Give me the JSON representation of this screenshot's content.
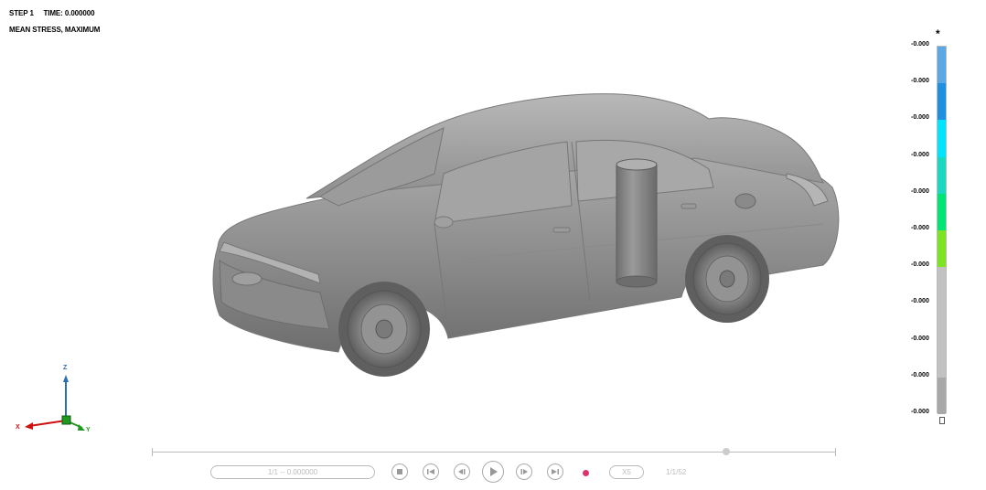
{
  "header": {
    "step_label": "STEP 1",
    "time_label": "TIME: 0.000000",
    "result_label": "MEAN STRESS, MAXIMUM"
  },
  "triad": {
    "z_label": "Z",
    "x_label": "X",
    "y_label": "Y"
  },
  "legend": {
    "title_symbol": "*",
    "tick_labels": [
      "-0.000",
      "-0.000",
      "-0.000",
      "-0.000",
      "-0.000",
      "-0.000",
      "-0.000",
      "-0.000",
      "-0.000",
      "-0.000",
      "-0.000"
    ],
    "segment_colors": [
      "#5aa9e6",
      "#1e90e0",
      "#00e5ff",
      "#1ad9c0",
      "#00e676",
      "#7ee321",
      "#c2c2c2",
      "#c2c2c2",
      "#c2c2c2",
      "#a8a8a8"
    ]
  },
  "playback": {
    "time_field": "1/1 -- 0.000000",
    "speed_label": "X5",
    "frame_counter": "1/1/52",
    "progress": 0.84
  }
}
